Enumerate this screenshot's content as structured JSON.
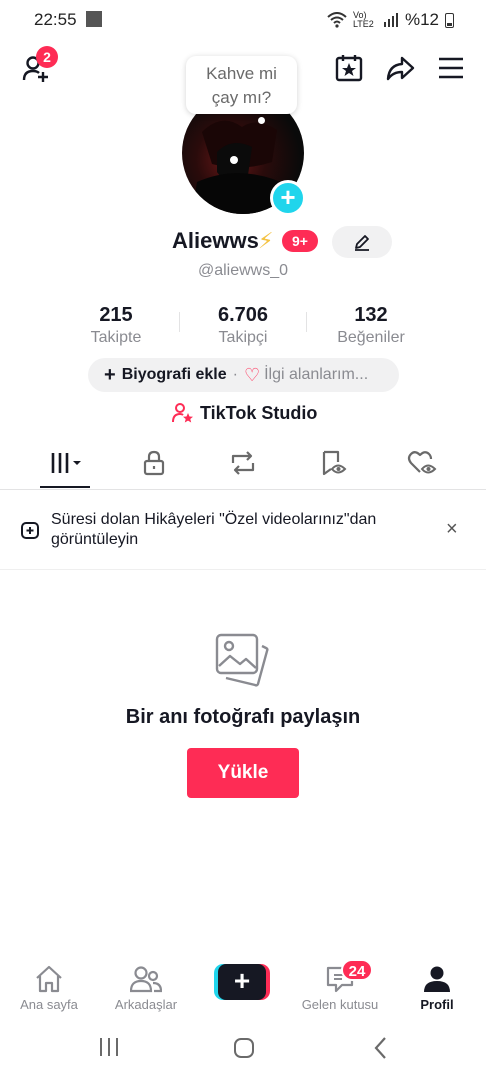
{
  "status_bar": {
    "time": "22:55",
    "network": "Vo) LTE2",
    "battery": "%12"
  },
  "header": {
    "add_friends_badge": "2"
  },
  "profile": {
    "bubble_text_line1": "Kahve mi",
    "bubble_text_line2": "çay mı?",
    "username": "Aliewws",
    "level_badge": "9+",
    "handle": "@aliewws_0"
  },
  "stats": [
    {
      "value": "215",
      "label": "Takipte"
    },
    {
      "value": "6.706",
      "label": "Takipçi"
    },
    {
      "value": "132",
      "label": "Beğeniler"
    }
  ],
  "bio_bar": {
    "add_bio": "Biyografi ekle",
    "separator": "·",
    "interests": "İlgi alanlarım..."
  },
  "studio": {
    "label": "TikTok Studio"
  },
  "notice": {
    "text": "Süresi dolan Hikâyeleri \"Özel videolarınız\"dan görüntüleyin",
    "close": "×"
  },
  "empty_state": {
    "title": "Bir anı fotoğrafı paylaşın",
    "upload_label": "Yükle"
  },
  "bottom_nav": {
    "home": "Ana sayfa",
    "friends": "Arkadaşlar",
    "inbox": "Gelen kutusu",
    "inbox_badge": "24",
    "profile": "Profil"
  },
  "colors": {
    "accent": "#fe2c55",
    "cyan": "#20d5ec",
    "text": "#161823",
    "muted": "#8a8b91"
  }
}
